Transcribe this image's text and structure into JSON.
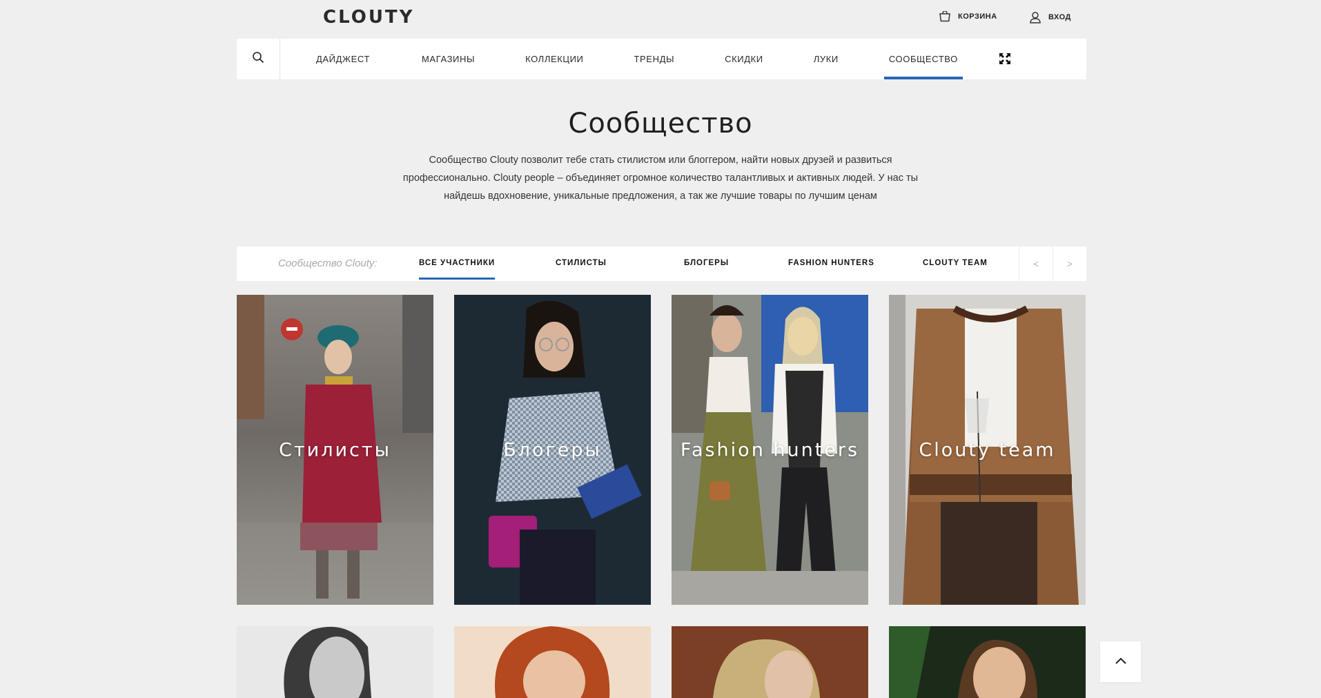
{
  "header": {
    "logo": "CLOUTY",
    "cart_label": "КОРЗИНА",
    "login_label": "ВХОД"
  },
  "nav": {
    "items": [
      {
        "label": "ДАЙДЖЕСТ"
      },
      {
        "label": "МАГАЗИНЫ"
      },
      {
        "label": "КОЛЛЕКЦИИ"
      },
      {
        "label": "ТРЕНДЫ"
      },
      {
        "label": "СКИДКИ"
      },
      {
        "label": "ЛУКИ"
      },
      {
        "label": "СООБЩЕСТВО"
      }
    ],
    "active": "СООБЩЕСТВО"
  },
  "hero": {
    "title": "Сообщество",
    "description": "Сообщество Clouty позволит тебе стать стилистом или блоггером, найти новых друзей и развиться профессионально. Clouty people – объединяет огромное количество талантливых и активных людей. У нас ты найдешь вдохновение, уникальные предложения, а так же лучшие товары по лучшим ценам"
  },
  "filter": {
    "label": "Сообщество Clouty:",
    "tabs": [
      {
        "label": "ВСЕ УЧАСТНИКИ"
      },
      {
        "label": "СТИЛИСТЫ"
      },
      {
        "label": "БЛОГЕРЫ"
      },
      {
        "label": "FASHION HUNTERS"
      },
      {
        "label": "CLOUTY TEAM"
      }
    ],
    "active": "ВСЕ УЧАСТНИКИ",
    "prev": "<",
    "next": ">"
  },
  "cards": [
    {
      "label": "Стилисты"
    },
    {
      "label": "Блогеры"
    },
    {
      "label": "Fashion hunters"
    },
    {
      "label": "Clouty team"
    }
  ],
  "colors": {
    "accent": "#2667b7",
    "background": "#efefef"
  }
}
